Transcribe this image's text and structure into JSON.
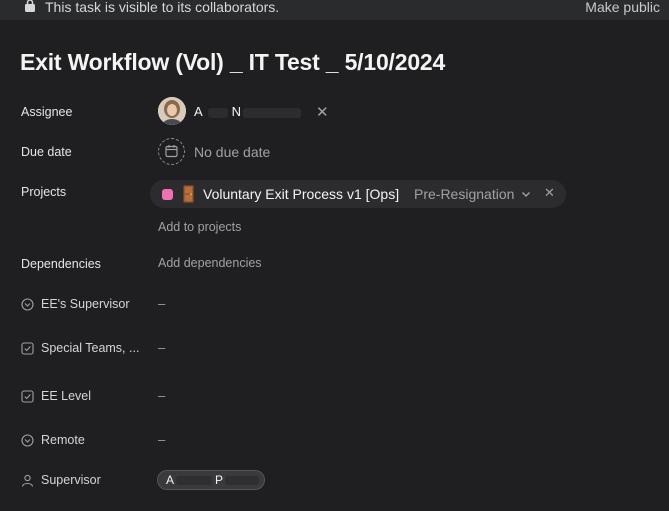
{
  "banner": {
    "message": "This task is visible to its collaborators.",
    "make_public_label": "Make public"
  },
  "task": {
    "title": "Exit Workflow (Vol) _ IT Test _ 5/10/2024"
  },
  "fields": {
    "assignee": {
      "label": "Assignee",
      "name": "A",
      "name_second": "N"
    },
    "due_date": {
      "label": "Due date",
      "value": "No due date"
    },
    "projects": {
      "label": "Projects",
      "project_name": "Voluntary Exit Process v1 [Ops]",
      "section": "Pre-Resignation",
      "swatch_color": "#f26fb2",
      "add_label": "Add to projects"
    },
    "dependencies": {
      "label": "Dependencies",
      "add_label": "Add dependencies"
    },
    "custom": [
      {
        "label": "EE's Supervisor",
        "value": "–",
        "icon": "dropdown-circle-icon"
      },
      {
        "label": "Special Teams, ...",
        "value": "–",
        "icon": "checkbox-icon"
      },
      {
        "label": "EE Level",
        "value": "–",
        "icon": "checkbox-icon"
      },
      {
        "label": "Remote",
        "value": "–",
        "icon": "dropdown-circle-icon"
      },
      {
        "label": "Supervisor",
        "icon": "person-icon",
        "value_first": "A",
        "value_second": "P"
      }
    ]
  }
}
